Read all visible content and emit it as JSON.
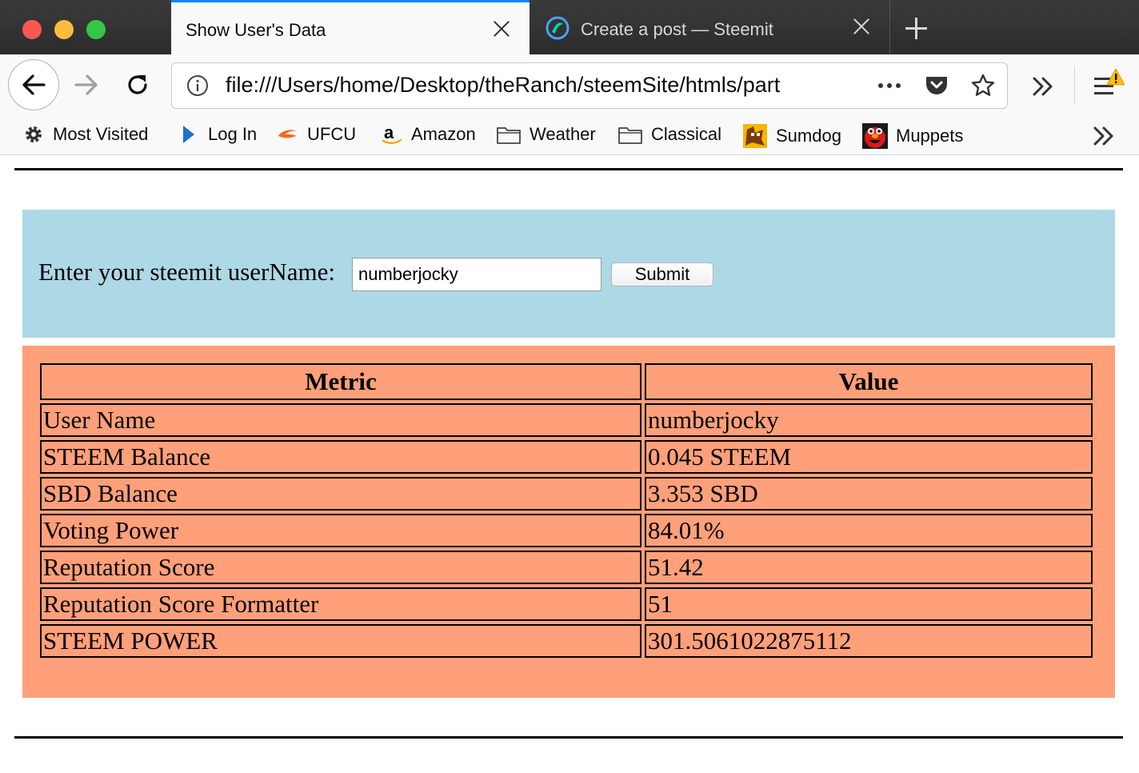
{
  "browser": {
    "tabs": [
      {
        "title": "Show User's Data",
        "active": true
      },
      {
        "title": "Create a post — Steemit",
        "active": false
      }
    ],
    "url": "file:///Users/home/Desktop/theRanch/steemSite/htmls/part",
    "bookmarks": [
      {
        "label": "Most Visited",
        "icon": "gear-icon"
      },
      {
        "label": "Log In",
        "icon": "play-arrow-icon"
      },
      {
        "label": "UFCU",
        "icon": "ufcu-logo-icon"
      },
      {
        "label": "Amazon",
        "icon": "amazon-logo-icon"
      },
      {
        "label": "Weather",
        "icon": "folder-icon"
      },
      {
        "label": "Classical",
        "icon": "folder-icon"
      },
      {
        "label": "Sumdog",
        "icon": "sumdog-logo-icon"
      },
      {
        "label": "Muppets",
        "icon": "elmo-icon"
      }
    ],
    "accent_color": "#0a84ff"
  },
  "form": {
    "label": "Enter your steemit userName:",
    "input_value": "numberjocky",
    "submit_label": "Submit",
    "panel_color": "#add8e6"
  },
  "table": {
    "panel_color": "#ffa07a",
    "headers": [
      "Metric",
      "Value"
    ],
    "rows": [
      [
        "User Name",
        "numberjocky"
      ],
      [
        "STEEM Balance",
        "0.045 STEEM"
      ],
      [
        "SBD Balance",
        "3.353 SBD"
      ],
      [
        "Voting Power",
        "84.01%"
      ],
      [
        "Reputation Score",
        "51.42"
      ],
      [
        "Reputation Score Formatter",
        "51"
      ],
      [
        "STEEM POWER",
        "301.5061022875112"
      ]
    ]
  }
}
